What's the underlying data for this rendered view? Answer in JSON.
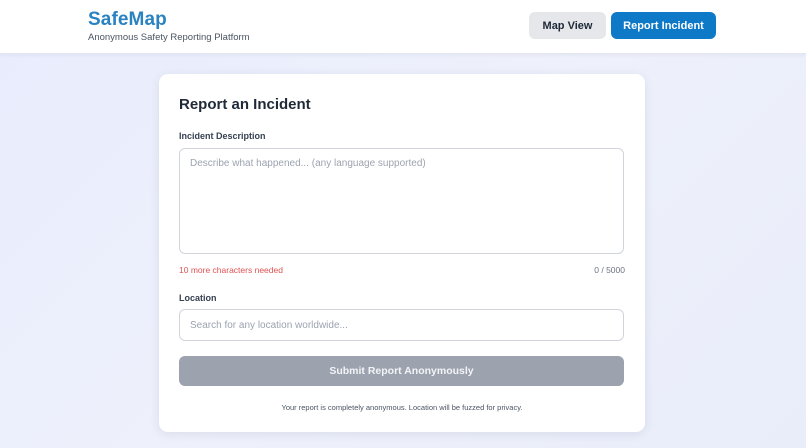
{
  "header": {
    "title": "SafeMap",
    "subtitle": "Anonymous Safety Reporting Platform",
    "nav": {
      "map_view_label": "Map View",
      "report_incident_label": "Report Incident"
    }
  },
  "form": {
    "title": "Report an Incident",
    "description": {
      "label": "Incident Description",
      "value": "",
      "placeholder": "Describe what happened... (any language supported)",
      "error_hint": "10 more characters needed",
      "char_count": "0 / 5000"
    },
    "location": {
      "label": "Location",
      "value": "",
      "placeholder": "Search for any location worldwide..."
    },
    "submit_label": "Submit Report Anonymously",
    "footnote": "Your report is completely anonymous. Location will be fuzzed for privacy."
  },
  "colors": {
    "brand": "#2a82c1",
    "primary_button": "#0e79c7",
    "secondary_button": "#e5e7eb",
    "disabled_button": "#9ca3af",
    "error_text": "#e05252"
  }
}
